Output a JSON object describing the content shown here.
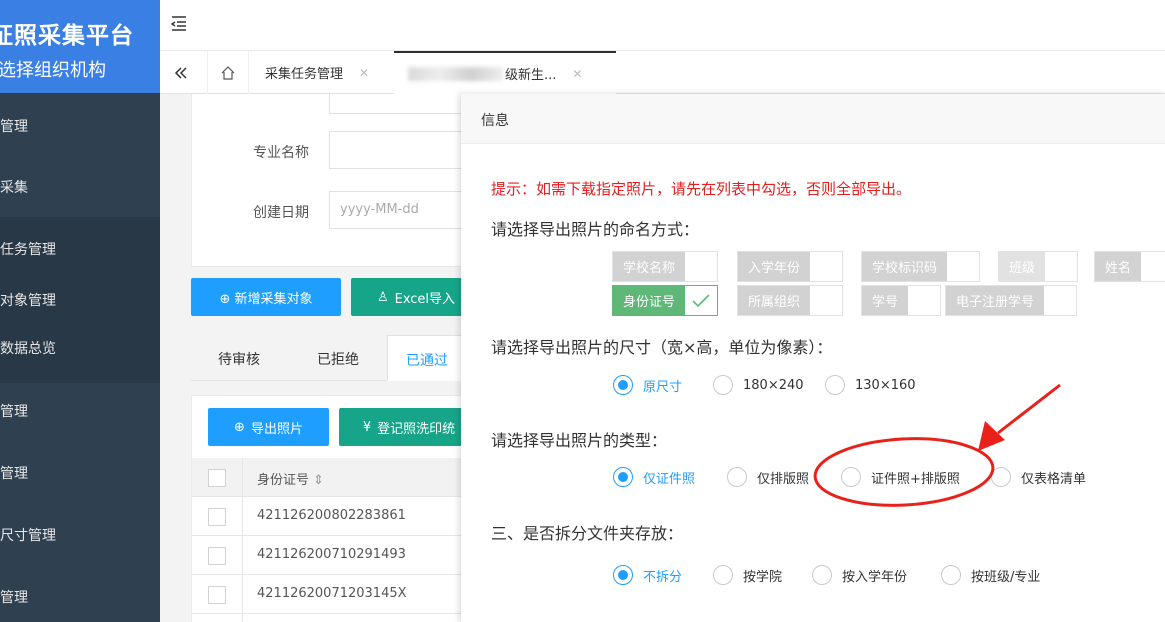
{
  "app": {
    "title": "证照采集平台",
    "subtitle": "选择组织机构"
  },
  "sidebar": {
    "items": [
      {
        "label": "校管理"
      },
      {
        "label": "片采集"
      },
      {
        "label": "集任务管理"
      },
      {
        "label": "集对象管理"
      },
      {
        "label": "集数据总览"
      },
      {
        "label": "业管理"
      },
      {
        "label": "票管理"
      },
      {
        "label": "片尺寸管理"
      },
      {
        "label": "统管理"
      }
    ]
  },
  "tabs": {
    "items": [
      {
        "label": "采集任务管理"
      },
      {
        "label": "级新生..."
      }
    ]
  },
  "form": {
    "major_label": "专业名称",
    "date_label": "创建日期",
    "date_placeholder": "yyyy-MM-dd",
    "add_button": "⊕ 新增采集对象",
    "excel_button": "Excel导入"
  },
  "status_tabs": [
    "待审核",
    "已拒绝",
    "已通过"
  ],
  "table": {
    "export_button": "导出照片",
    "register_button": "登记照洗印统",
    "id_header": "身份证号",
    "rows": [
      "421126200802283861",
      "421126200710291493",
      "42112620071203145X"
    ]
  },
  "modal": {
    "title": "信息",
    "tip": "提示：如需下载指定照片，请先在列表中勾选，否则全部导出。",
    "naming": {
      "question": "请选择导出照片的命名方式：",
      "options": [
        "学校名称",
        "入学年份",
        "学校标识码",
        "班级",
        "姓名",
        "身份证号",
        "所属组织",
        "学号",
        "电子注册学号"
      ],
      "selected": "身份证号"
    },
    "size": {
      "question": "请选择导出照片的尺寸（宽×高，单位为像素）：",
      "options": [
        "原尺寸",
        "180×240",
        "130×160"
      ],
      "selected": "原尺寸"
    },
    "type": {
      "question": "请选择导出照片的类型：",
      "options": [
        "仅证件照",
        "仅排版照",
        "证件照+排版照",
        "仅表格清单"
      ],
      "selected": "仅证件照"
    },
    "split": {
      "question": "三、是否拆分文件夹存放：",
      "options": [
        "不拆分",
        "按学院",
        "按入学年份",
        "按班级/专业"
      ],
      "selected": "不拆分"
    }
  },
  "colors": {
    "brand": "#3a7fe3",
    "sidebar": "#2f4050",
    "accent_blue": "#1e9fff",
    "checkbox_on": "#5fb878",
    "tip_red": "#e31e1e",
    "annotation_red": "#e8221b"
  }
}
